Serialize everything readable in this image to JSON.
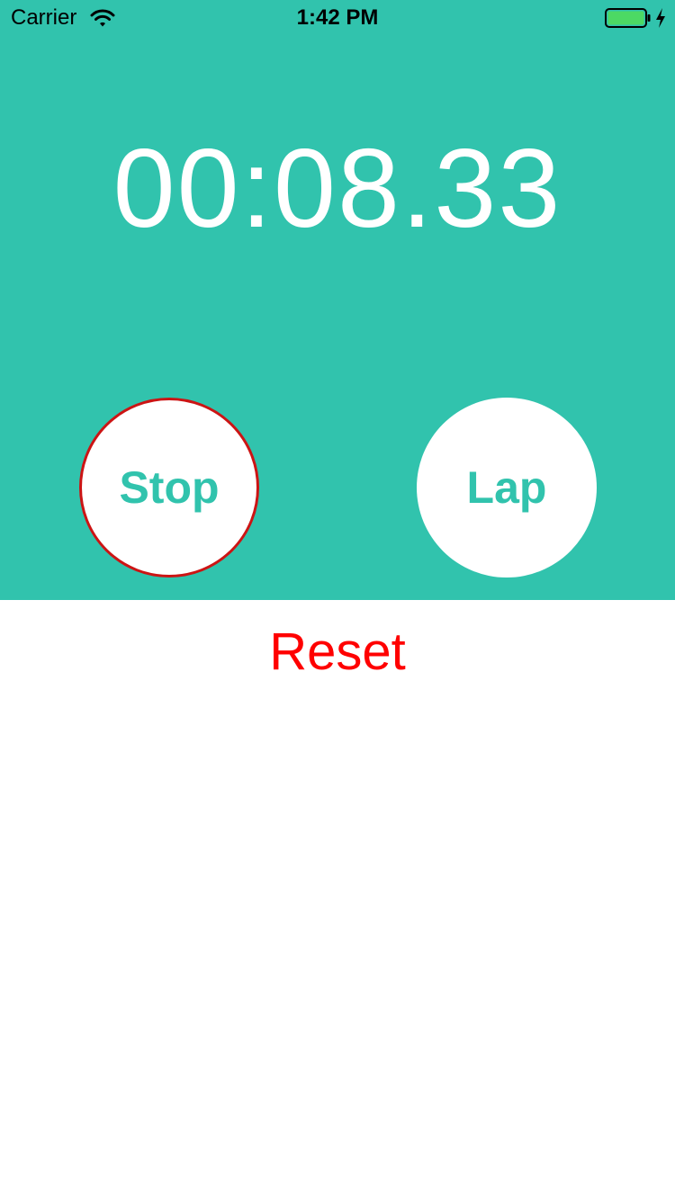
{
  "status_bar": {
    "carrier": "Carrier",
    "time": "1:42 PM",
    "wifi_icon": "wifi-icon",
    "battery_icon": "battery-icon",
    "charging_icon": "bolt-icon",
    "battery_level": 1.0,
    "battery_color": "#4cd964"
  },
  "timer": {
    "display": "00:08.33"
  },
  "controls": {
    "stop_label": "Stop",
    "lap_label": "Lap",
    "reset_label": "Reset"
  },
  "colors": {
    "accent": "#31c3ad",
    "stop_border": "#cc1414",
    "reset_text": "#ff0000",
    "button_background": "#ffffff"
  }
}
